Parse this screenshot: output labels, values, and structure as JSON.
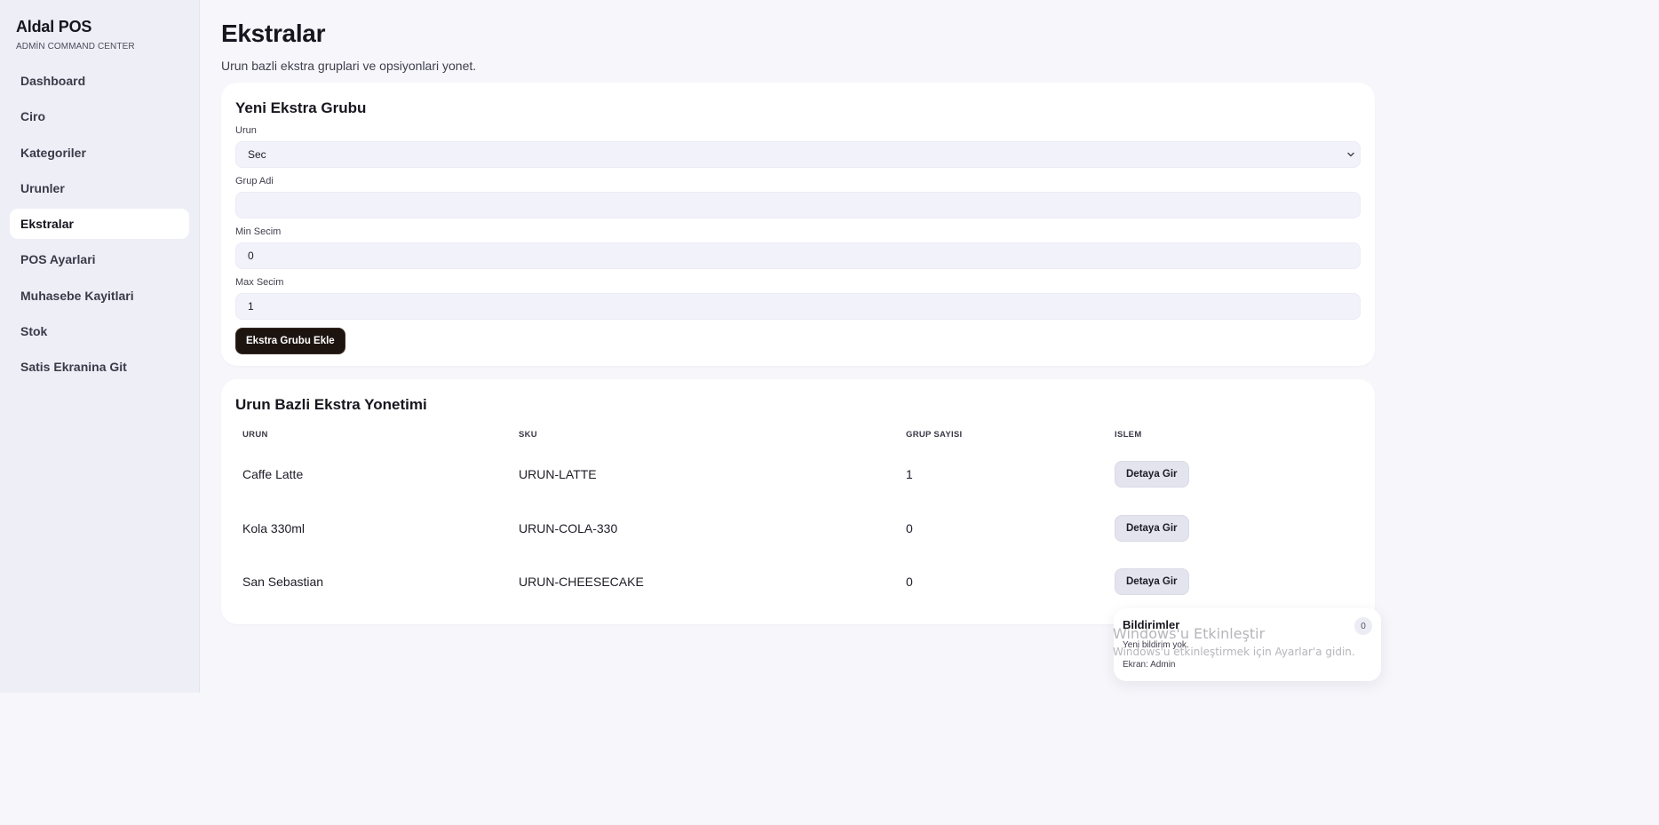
{
  "sidebar": {
    "brand_title": "Aldal POS",
    "brand_subtitle": "ADMİN COMMAND CENTER",
    "items": [
      {
        "label": "Dashboard"
      },
      {
        "label": "Ciro"
      },
      {
        "label": "Kategoriler"
      },
      {
        "label": "Urunler"
      },
      {
        "label": "Ekstralar",
        "active": true
      },
      {
        "label": "POS Ayarlari"
      },
      {
        "label": "Muhasebe Kayitlari"
      },
      {
        "label": "Stok"
      },
      {
        "label": "Satis Ekranina Git"
      }
    ]
  },
  "header": {
    "title": "Ekstralar",
    "subtitle": "Urun bazli ekstra gruplari ve opsiyonlari yonet."
  },
  "form": {
    "title": "Yeni Ekstra Grubu",
    "product_label": "Urun",
    "product_value": "Sec",
    "group_name_label": "Grup Adi",
    "group_name_value": "",
    "min_label": "Min Secim",
    "min_value": "0",
    "max_label": "Max Secim",
    "max_value": "1",
    "submit_label": "Ekstra Grubu Ekle"
  },
  "table": {
    "title": "Urun Bazli Ekstra Yonetimi",
    "columns": [
      "URUN",
      "SKU",
      "GRUP SAYISI",
      "ISLEM"
    ],
    "rows": [
      {
        "product": "Caffe Latte",
        "sku": "URUN-LATTE",
        "groups": "1",
        "action": "Detaya Gir"
      },
      {
        "product": "Kola 330ml",
        "sku": "URUN-COLA-330",
        "groups": "0",
        "action": "Detaya Gir"
      },
      {
        "product": "San Sebastian",
        "sku": "URUN-CHEESECAKE",
        "groups": "0",
        "action": "Detaya Gir"
      }
    ]
  },
  "notifications": {
    "title": "Bildirimler",
    "count": "0",
    "empty_text": "Yeni bildirim yok.",
    "screen_text": "Ekran: Admin"
  },
  "watermark": {
    "title": "Windows'u Etkinleştir",
    "subtitle": "Windows'u etkinleştirmek için Ayarlar'a gidin."
  },
  "colors": {
    "background": "#f6f6fb",
    "sidebar": "#eeeef7",
    "primary_button": "#1d1410",
    "input_bg": "#f2f2fb"
  }
}
